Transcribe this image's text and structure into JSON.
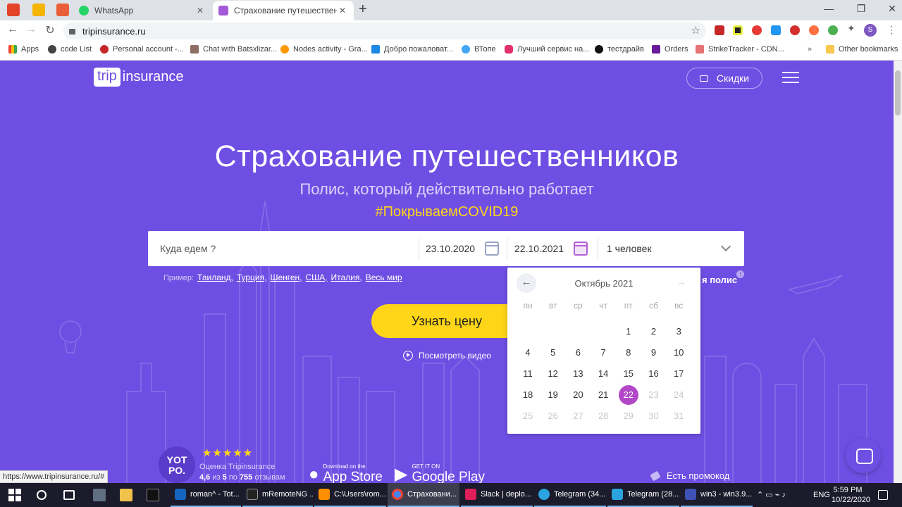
{
  "browser": {
    "tabs": [
      {
        "title": "WhatsApp",
        "active": false
      },
      {
        "title": "Страхование путешественников",
        "active": true
      }
    ],
    "url": "tripinsurance.ru",
    "bookmarks": [
      "Apps",
      "code List",
      "Personal account -...",
      "Chat with Batsxlizar...",
      "Nodes activity - Gra...",
      "Добро пожаловат...",
      "ВТопе",
      "Лучший сервис на...",
      "тестдрайв",
      "Orders",
      "StrikeTracker - CDN...",
      "Other bookmarks"
    ],
    "profile_letter": "S",
    "status_url": "https://www.tripinsurance.ru/#"
  },
  "site": {
    "logo_box": "trip",
    "logo_text": "insurance",
    "discount_label": "Скидки",
    "title": "Страхование путешественников",
    "subtitle": "Полис, который действительно работает",
    "hashtag": "#ПокрываемCOVID19",
    "form": {
      "destination_placeholder": "Куда едем ?",
      "date_from": "23.10.2020",
      "date_to": "22.10.2021",
      "persons": "1 человек"
    },
    "examples_label": "Пример:",
    "examples": [
      "Таиланд,",
      "Турция,",
      "Шенген,",
      "США,",
      "Италия,",
      "Весь мир"
    ],
    "cta": "Узнать цену",
    "video_link": "Посмотреть видео",
    "polis_partial": "я полис",
    "info_mark": "!",
    "calendar": {
      "title": "Октябрь 2021",
      "prev": "←",
      "next": "→",
      "weekdays": [
        "пн",
        "вт",
        "ср",
        "чт",
        "пт",
        "сб",
        "вс"
      ],
      "selected": 22
    },
    "yotpo": {
      "logo": "YOT PO.",
      "stars": "★★★★★",
      "line1": "Оценка Tripinsurance",
      "line2_pre": "4,6",
      "line2_mid1": " из ",
      "line2_max": "5",
      "line2_mid2": " по ",
      "line2_count": "755",
      "line2_post": " отзывам"
    },
    "app_store": {
      "small": "Download on the",
      "big": "App Store"
    },
    "google_play": {
      "small": "GET IT ON",
      "big": "Google Play"
    },
    "promo": "Есть промокод"
  },
  "taskbar": {
    "apps": [
      {
        "label": "roman^ - Tot..."
      },
      {
        "label": "mRemoteNG ..."
      },
      {
        "label": "C:\\Users\\rom..."
      },
      {
        "label": "Страховани..."
      },
      {
        "label": "Slack | deplo..."
      },
      {
        "label": "Telegram (34..."
      },
      {
        "label": "Telegram (28..."
      },
      {
        "label": "win3 - win3.9..."
      }
    ],
    "lang": "ENG",
    "time": "5:59 PM",
    "date": "10/22/2020"
  },
  "colors": {
    "brand": "#6f4fe3",
    "cta": "#ffd617",
    "selected_day": "#b248c7"
  }
}
